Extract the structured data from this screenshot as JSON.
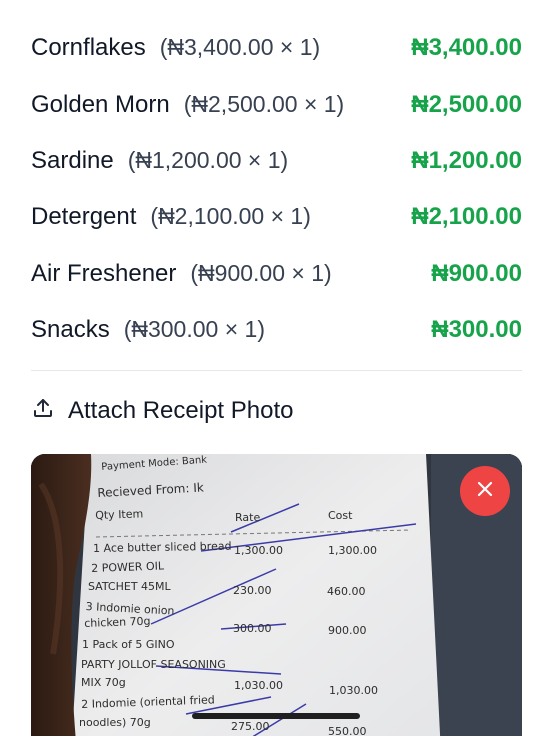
{
  "items": [
    {
      "name": "Cornflakes",
      "qty": "(₦3,400.00 × 1)",
      "total": "₦3,400.00"
    },
    {
      "name": "Golden Morn",
      "qty": "(₦2,500.00 × 1)",
      "total": "₦2,500.00"
    },
    {
      "name": "Sardine",
      "qty": "(₦1,200.00 × 1)",
      "total": "₦1,200.00"
    },
    {
      "name": "Detergent",
      "qty": "(₦2,100.00 × 1)",
      "total": "₦2,100.00"
    },
    {
      "name": "Air Freshener",
      "qty": "(₦900.00 × 1)",
      "total": "₦900.00"
    },
    {
      "name": "Snacks",
      "qty": "(₦300.00 × 1)",
      "total": "₦300.00"
    }
  ],
  "attach": {
    "title": "Attach Receipt Photo"
  },
  "receipt": {
    "payment_mode": "Payment Mode: Bank",
    "received_from": "Recieved From: Ik",
    "col_qty_item": "Qty   Item",
    "col_rate": "Rate",
    "col_cost": "Cost",
    "line1_desc": "1  Ace butter sliced bread",
    "line1_rate": "1,300.00",
    "line1_cost": "1,300.00",
    "line2_desc": "2  POWER OIL",
    "line2_desc2": "SATCHET 45ML",
    "line2_rate": "230.00",
    "line2_cost": "460.00",
    "line3_desc": "3  Indomie onion",
    "line3_desc2": "chicken 70g",
    "line3_rate": "300.00",
    "line3_cost": "900.00",
    "line4_desc": "1 Pack of 5  GINO",
    "line4_desc2": "PARTY JOLLOF SEASONING",
    "line4_desc3": "MIX 70g",
    "line4_rate": "1,030.00",
    "line4_cost": "1,030.00",
    "line5_desc": "2  Indomie (oriental fried",
    "line5_desc2": "noodles) 70g",
    "line5_rate": "275.00",
    "line5_cost": "550.00"
  },
  "colors": {
    "accent_green": "#16a34a",
    "remove_red": "#ef4444"
  },
  "icons": {
    "attach": "upload-icon",
    "remove": "close-icon"
  }
}
